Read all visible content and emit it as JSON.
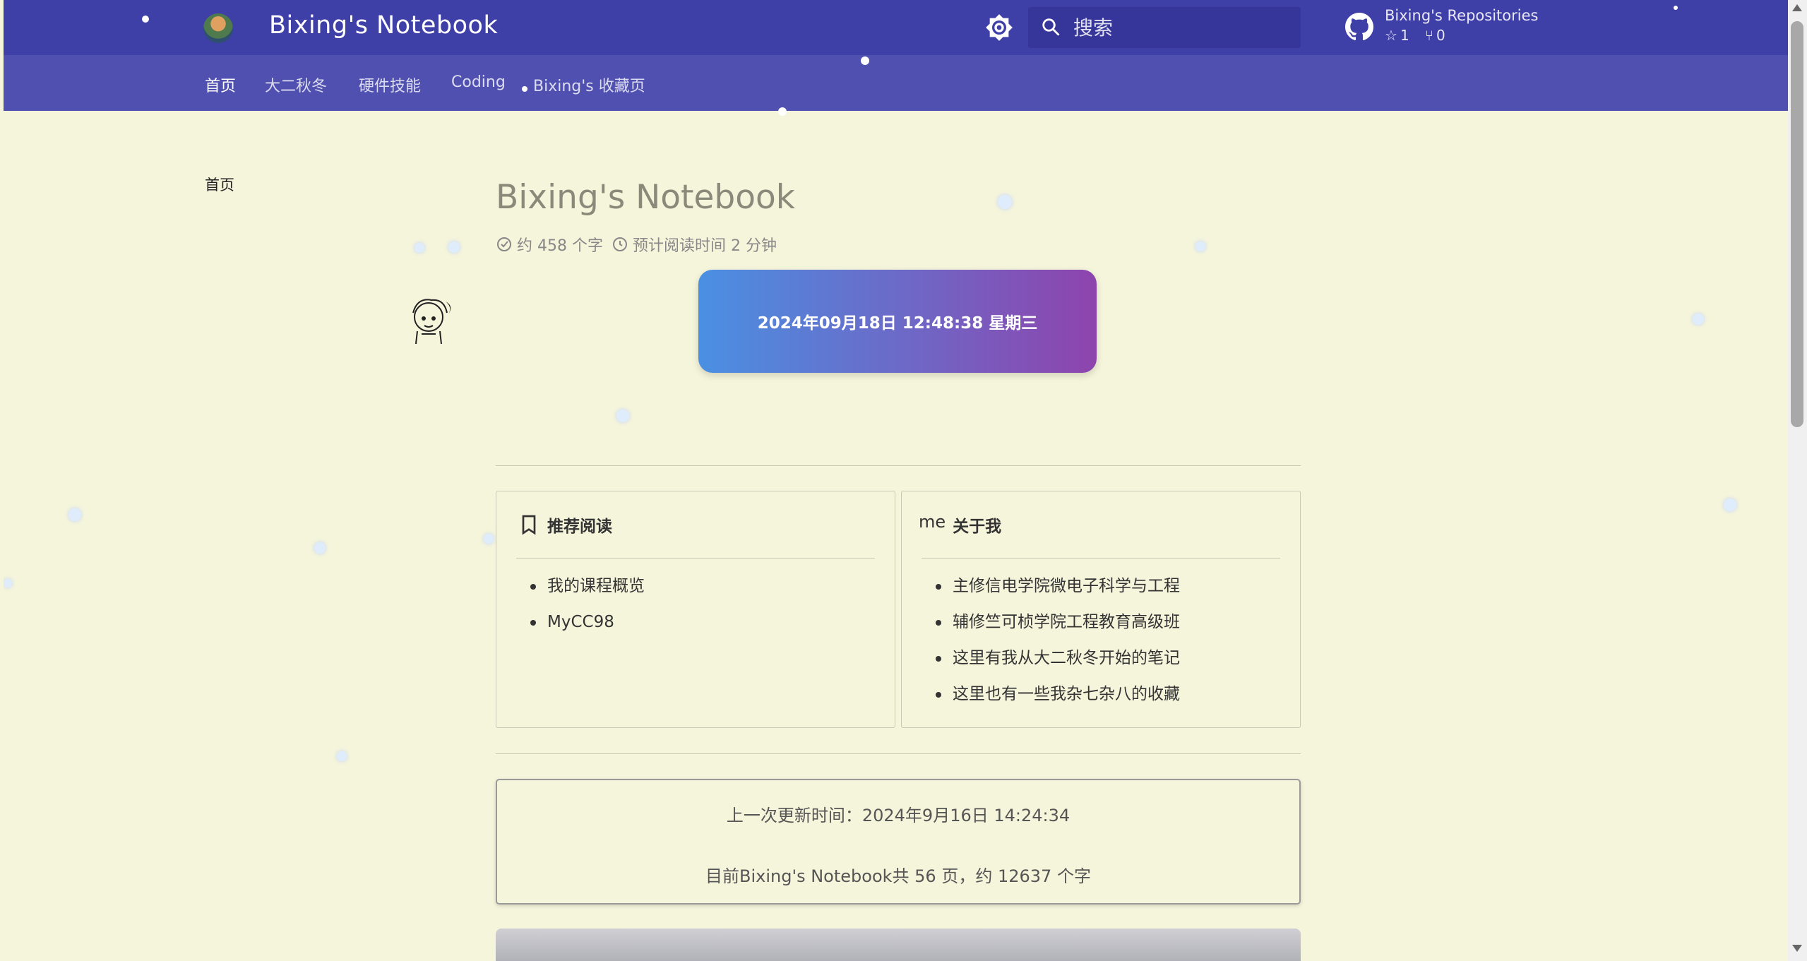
{
  "header": {
    "site_title": "Bixing's Notebook",
    "search_placeholder": "搜索",
    "repo": {
      "name": "Bixing's Repositories",
      "stars": "1",
      "forks": "0"
    }
  },
  "tabs": [
    {
      "label": "首页",
      "active": true
    },
    {
      "label": "大二秋冬",
      "active": false
    },
    {
      "label": "硬件技能",
      "active": false
    },
    {
      "label": "Coding",
      "active": false
    },
    {
      "label": "Bixing's 收藏页",
      "active": false
    }
  ],
  "sidebar": {
    "home_label": "首页"
  },
  "page": {
    "title": "Bixing's Notebook",
    "word_count": "约 458 个字",
    "read_time": "预计阅读时间 2 分钟",
    "clock": "2024年09月18日 12:48:38 星期三"
  },
  "cards": {
    "recommended": {
      "title": "推荐阅读",
      "items": [
        "我的课程概览",
        "MyCC98"
      ]
    },
    "about": {
      "prefix": "me",
      "title": "关于我",
      "items": [
        "主修信电学院微电子科学与工程",
        "辅修竺可桢学院工程教育高级班",
        "这里有我从大二秋冬开始的笔记",
        "这里也有一些我杂七杂八的收藏"
      ]
    }
  },
  "stats": {
    "last_updated": "上一次更新时间：2024年9月16日 14:24:34",
    "summary": "目前Bixing's Notebook共 56 页，约 12637 个字"
  },
  "colors": {
    "header": "#3f3fa8",
    "tabs_bar": "#5050b0",
    "background": "#f5f5dc",
    "clock_gradient_start": "#4a90e2",
    "clock_gradient_end": "#8e44ad"
  }
}
